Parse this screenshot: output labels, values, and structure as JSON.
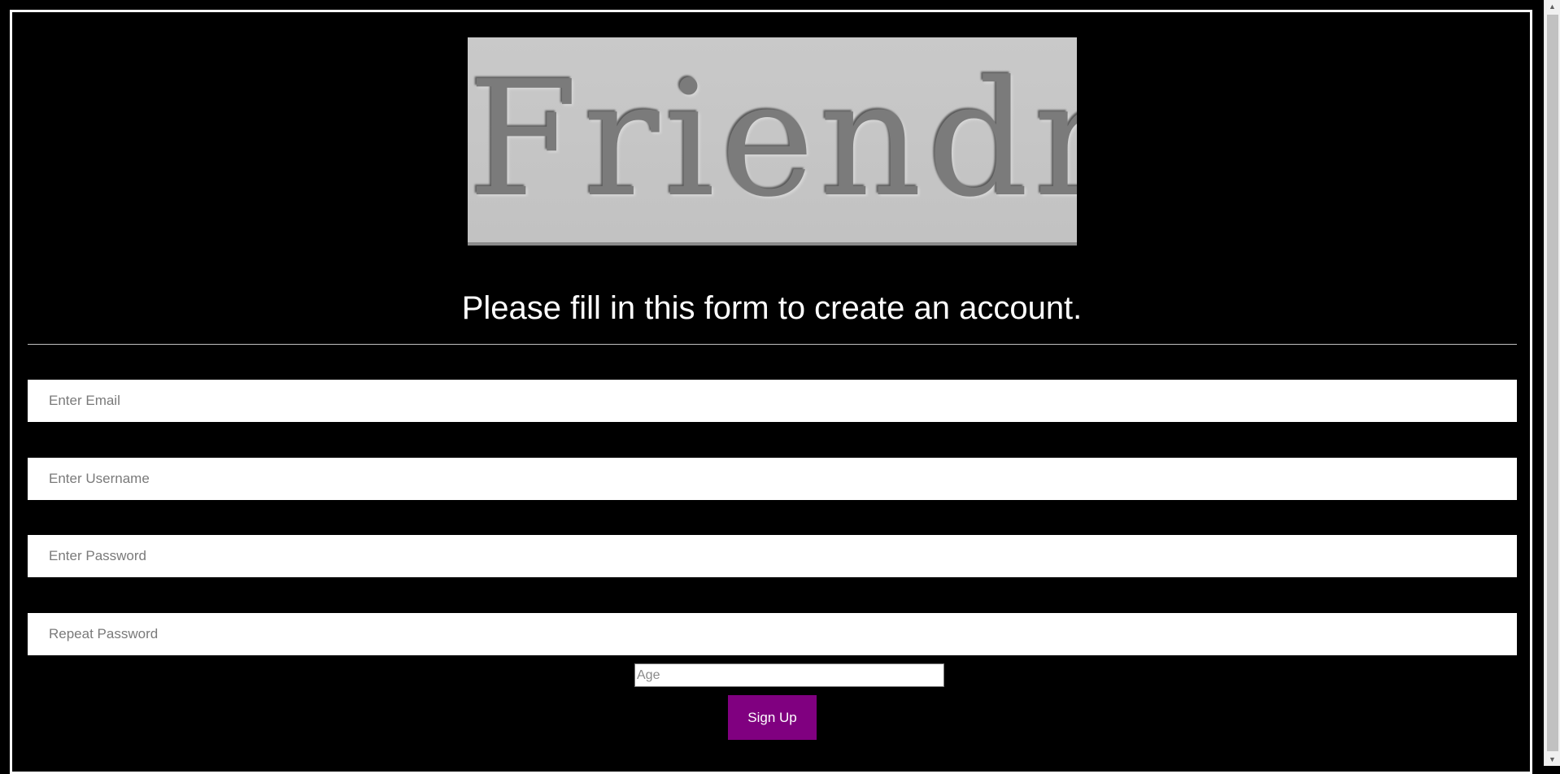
{
  "logo": {
    "text": "Friendr"
  },
  "form": {
    "heading": "Please fill in this form to create an account.",
    "email_placeholder": "Enter Email",
    "username_placeholder": "Enter Username",
    "password_placeholder": "Enter Password",
    "repeat_password_placeholder": "Repeat Password",
    "age_placeholder": "Age",
    "signup_label": "Sign Up"
  },
  "colors": {
    "background": "#000000",
    "signup_button": "#800080",
    "text": "#ffffff"
  },
  "scrollbar": {
    "up_arrow": "▲",
    "down_arrow": "▼"
  }
}
